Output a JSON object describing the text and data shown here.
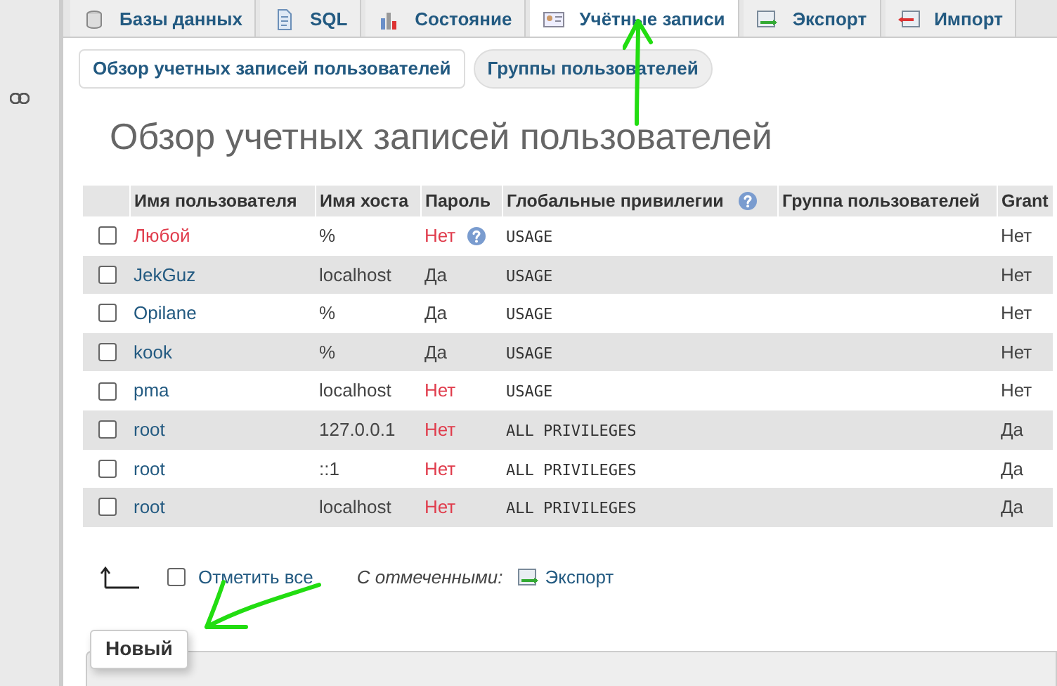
{
  "tabs": [
    {
      "label": "Базы данных",
      "selected": false
    },
    {
      "label": "SQL",
      "selected": false
    },
    {
      "label": "Состояние",
      "selected": false
    },
    {
      "label": "Учётные записи",
      "selected": true
    },
    {
      "label": "Экспорт",
      "selected": false
    },
    {
      "label": "Импорт",
      "selected": false
    }
  ],
  "subtabs": [
    {
      "label": "Обзор учетных записей пользователей",
      "selected": true
    },
    {
      "label": "Группы пользователей",
      "selected": false
    }
  ],
  "heading": "Обзор учетных записей пользователей",
  "table": {
    "columns": [
      "Имя пользователя",
      "Имя хоста",
      "Пароль",
      "Глобальные привилегии",
      "Группа пользователей",
      "Grant"
    ],
    "rows": [
      {
        "user": "Любой",
        "any_user": true,
        "host": "%",
        "password": "Нет",
        "password_warning": true,
        "password_help": true,
        "privileges": "USAGE",
        "grant": "Нет",
        "checked": false
      },
      {
        "user": "JekGuz",
        "any_user": false,
        "host": "localhost",
        "password": "Да",
        "password_warning": false,
        "password_help": false,
        "privileges": "USAGE",
        "grant": "Нет",
        "checked": false
      },
      {
        "user": "Opilane",
        "any_user": false,
        "host": "%",
        "password": "Да",
        "password_warning": false,
        "password_help": false,
        "privileges": "USAGE",
        "grant": "Нет",
        "checked": false
      },
      {
        "user": "kook",
        "any_user": false,
        "host": "%",
        "password": "Да",
        "password_warning": false,
        "password_help": false,
        "privileges": "USAGE",
        "grant": "Нет",
        "checked": false
      },
      {
        "user": "pma",
        "any_user": false,
        "host": "localhost",
        "password": "Нет",
        "password_warning": true,
        "password_help": false,
        "privileges": "USAGE",
        "grant": "Нет",
        "checked": false
      },
      {
        "user": "root",
        "any_user": false,
        "host": "127.0.0.1",
        "password": "Нет",
        "password_warning": true,
        "password_help": false,
        "privileges": "ALL PRIVILEGES",
        "grant": "Да",
        "checked": false
      },
      {
        "user": "root",
        "any_user": false,
        "host": "::1",
        "password": "Нет",
        "password_warning": true,
        "password_help": false,
        "privileges": "ALL PRIVILEGES",
        "grant": "Да",
        "checked": false
      },
      {
        "user": "root",
        "any_user": false,
        "host": "localhost",
        "password": "Нет",
        "password_warning": true,
        "password_help": false,
        "privileges": "ALL PRIVILEGES",
        "grant": "Да",
        "checked": false
      }
    ]
  },
  "footer": {
    "check_all": "Отметить все",
    "check_all_checked": false,
    "with_selected": "С отмеченными:",
    "export": "Экспорт"
  },
  "new_section": {
    "legend": "Новый"
  }
}
